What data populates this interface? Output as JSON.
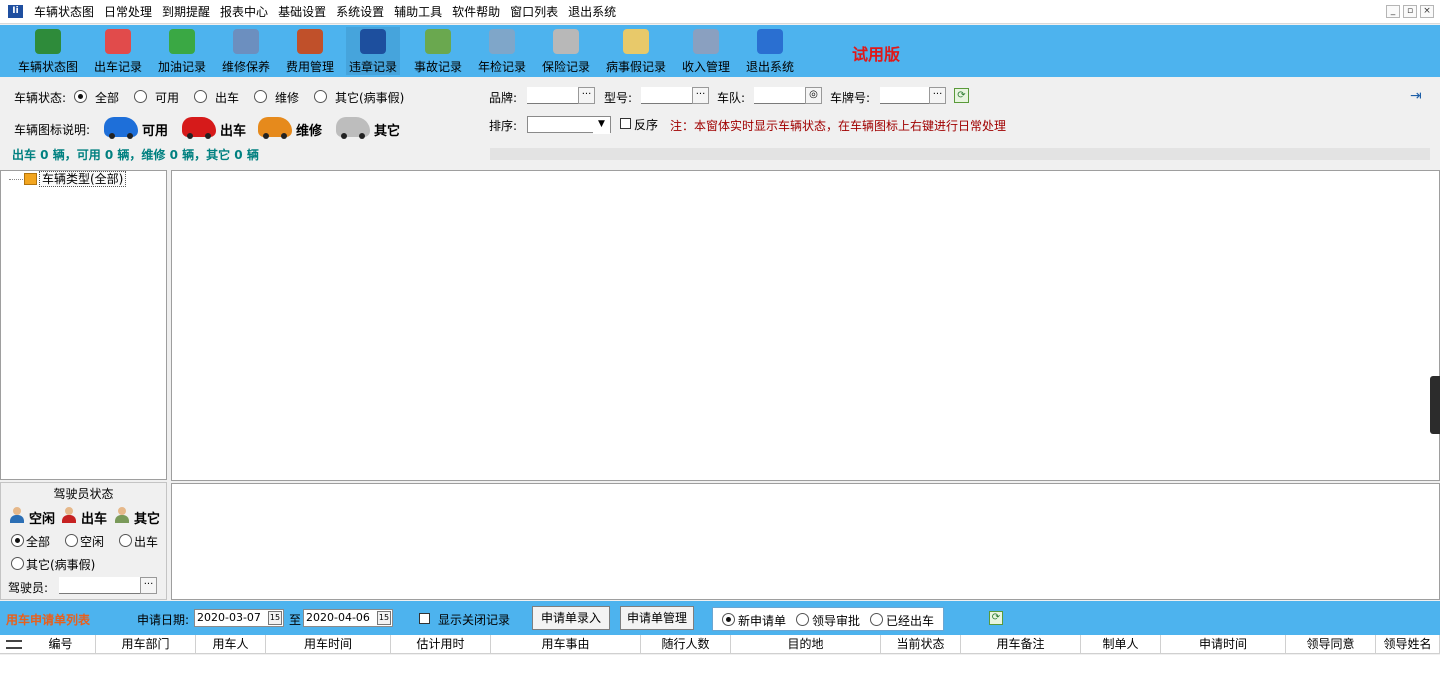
{
  "menu": {
    "items": [
      "车辆状态图",
      "日常处理",
      "到期提醒",
      "报表中心",
      "基础设置",
      "系统设置",
      "辅助工具",
      "软件帮助",
      "窗口列表",
      "退出系统"
    ],
    "window_buttons": [
      "_",
      "▫",
      "×"
    ]
  },
  "toolbar": {
    "buttons": [
      {
        "label": "车辆状态图",
        "icon": "money-bag-icon",
        "color": "#2e8b3a"
      },
      {
        "label": "出车记录",
        "icon": "car-out-icon",
        "color": "#e14b4b"
      },
      {
        "label": "加油记录",
        "icon": "fuel-icon",
        "color": "#3aa844"
      },
      {
        "label": "维修保养",
        "icon": "form-icon",
        "color": "#6c8fbf"
      },
      {
        "label": "费用管理",
        "icon": "cost-book-icon",
        "color": "#c0502a"
      },
      {
        "label": "违章记录",
        "icon": "info-icon",
        "color": "#1d4f9e"
      },
      {
        "label": "事故记录",
        "icon": "accident-icon",
        "color": "#6aa84f"
      },
      {
        "label": "年检记录",
        "icon": "chart-icon",
        "color": "#7fa6c9"
      },
      {
        "label": "保险记录",
        "icon": "calendar-icon",
        "color": "#b8b8b8"
      },
      {
        "label": "病事假记录",
        "icon": "clipboard-icon",
        "color": "#e8c96a"
      },
      {
        "label": "收入管理",
        "icon": "keyboard-icon",
        "color": "#8aa0c0"
      },
      {
        "label": "退出系统",
        "icon": "exit-icon",
        "color": "#2a6fd1"
      }
    ],
    "trial_label": "试用版"
  },
  "filters": {
    "status_label": "车辆状态:",
    "status_options": [
      "全部",
      "可用",
      "出车",
      "维修",
      "其它(病事假)"
    ],
    "status_selected": "全部",
    "brand_label": "品牌:",
    "model_label": "型号:",
    "team_label": "车队:",
    "plate_label": "车牌号:",
    "sort_label": "排序:",
    "reverse_label": "反序",
    "hint": "注：本窗体实时显示车辆状态，在车辆图标上右键进行日常处理",
    "legend_label": "车辆图标说明:",
    "legend": [
      {
        "label": "可用",
        "color": "#1e6fd9"
      },
      {
        "label": "出车",
        "color": "#d61a1a"
      },
      {
        "label": "维修",
        "color": "#e68a1c"
      },
      {
        "label": "其它",
        "color": "#bdbdbd"
      }
    ],
    "summary": "出车 0 辆，可用 0 辆，维修 0 辆，其它 0 辆"
  },
  "tree": {
    "root_label": "车辆类型(全部)"
  },
  "driver": {
    "title": "驾驶员状态",
    "legend": [
      {
        "label": "空闲",
        "color": "#2c6fb5"
      },
      {
        "label": "出车",
        "color": "#c62121"
      },
      {
        "label": "其它",
        "color": "#7a9a5a"
      }
    ],
    "options": [
      "全部",
      "空闲",
      "出车",
      "其它(病事假)"
    ],
    "selected": "全部",
    "driver_label": "驾驶员:"
  },
  "requests": {
    "title": "用车申请单列表",
    "date_label": "申请日期:",
    "date_from": "2020-03-07",
    "date_to": "2020-04-06",
    "to_label": "至",
    "show_closed_label": "显示关闭记录",
    "entry_button": "申请单录入",
    "manage_button": "申请单管理",
    "status_options": [
      "新申请单",
      "领导审批",
      "已经出车"
    ],
    "status_selected": "新申请单",
    "columns": [
      "编号",
      "用车部门",
      "用车人",
      "用车时间",
      "估计用时",
      "用车事由",
      "随行人数",
      "目的地",
      "当前状态",
      "用车备注",
      "制单人",
      "申请时间",
      "领导同意",
      "领导姓名"
    ]
  }
}
